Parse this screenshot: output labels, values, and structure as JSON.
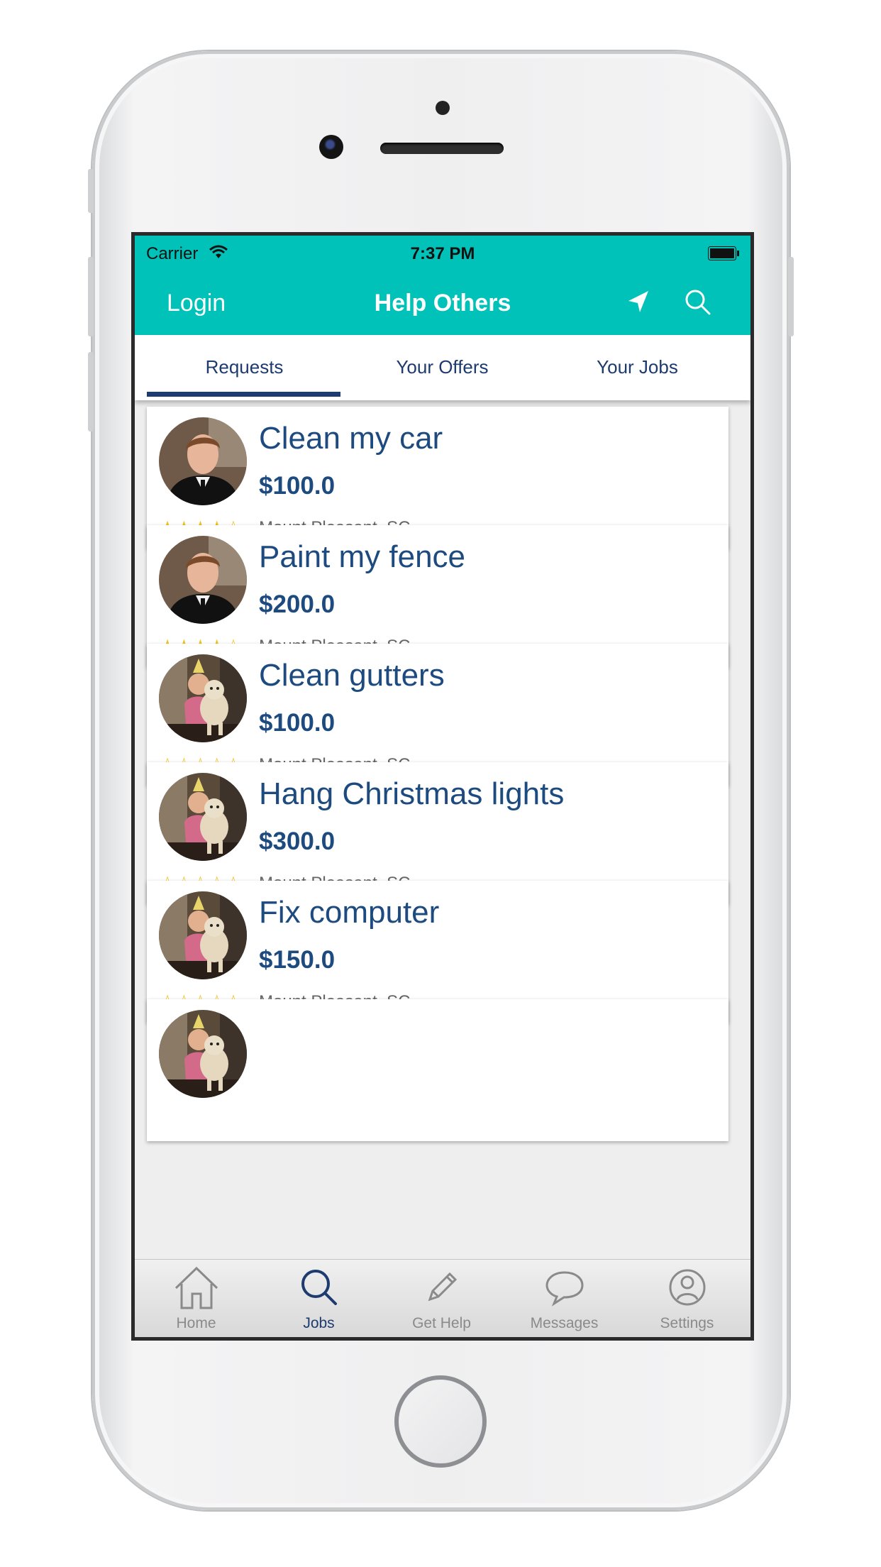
{
  "status_bar": {
    "carrier": "Carrier",
    "time": "7:37 PM"
  },
  "nav": {
    "login": "Login",
    "title": "Help Others",
    "icons": [
      "location-arrow-icon",
      "search-icon"
    ]
  },
  "tabs": [
    {
      "label": "Requests",
      "selected": true
    },
    {
      "label": "Your Offers",
      "selected": false
    },
    {
      "label": "Your Jobs",
      "selected": false
    }
  ],
  "jobs": [
    {
      "title": "Clean my car",
      "price": "$100.0",
      "location": "Mount Pleasant, SC",
      "rating": 4,
      "avatar": "man-in-suit"
    },
    {
      "title": "Paint my fence",
      "price": "$200.0",
      "location": "Mount Pleasant, SC",
      "rating": 4,
      "avatar": "man-in-suit"
    },
    {
      "title": "Clean gutters",
      "price": "$100.0",
      "location": "Mount Pleasant, SC",
      "rating": 0,
      "avatar": "girl-with-dog"
    },
    {
      "title": "Hang Christmas lights",
      "price": "$300.0",
      "location": "Mount Pleasant, SC",
      "rating": 0,
      "avatar": "girl-with-dog"
    },
    {
      "title": "Fix computer",
      "price": "$150.0",
      "location": "Mount Pleasant, SC",
      "rating": 0,
      "avatar": "girl-with-dog"
    }
  ],
  "tab_bar": [
    {
      "label": "Home",
      "icon": "home-icon",
      "active": false
    },
    {
      "label": "Jobs",
      "icon": "search-icon",
      "active": true
    },
    {
      "label": "Get Help",
      "icon": "pencil-icon",
      "active": false
    },
    {
      "label": "Messages",
      "icon": "chat-bubble-icon",
      "active": false
    },
    {
      "label": "Settings",
      "icon": "user-icon",
      "active": false
    }
  ],
  "colors": {
    "accent": "#00c2b8",
    "navy": "#1d3b6e",
    "title_blue": "#1d4a7f",
    "star": "#f2c21b"
  }
}
